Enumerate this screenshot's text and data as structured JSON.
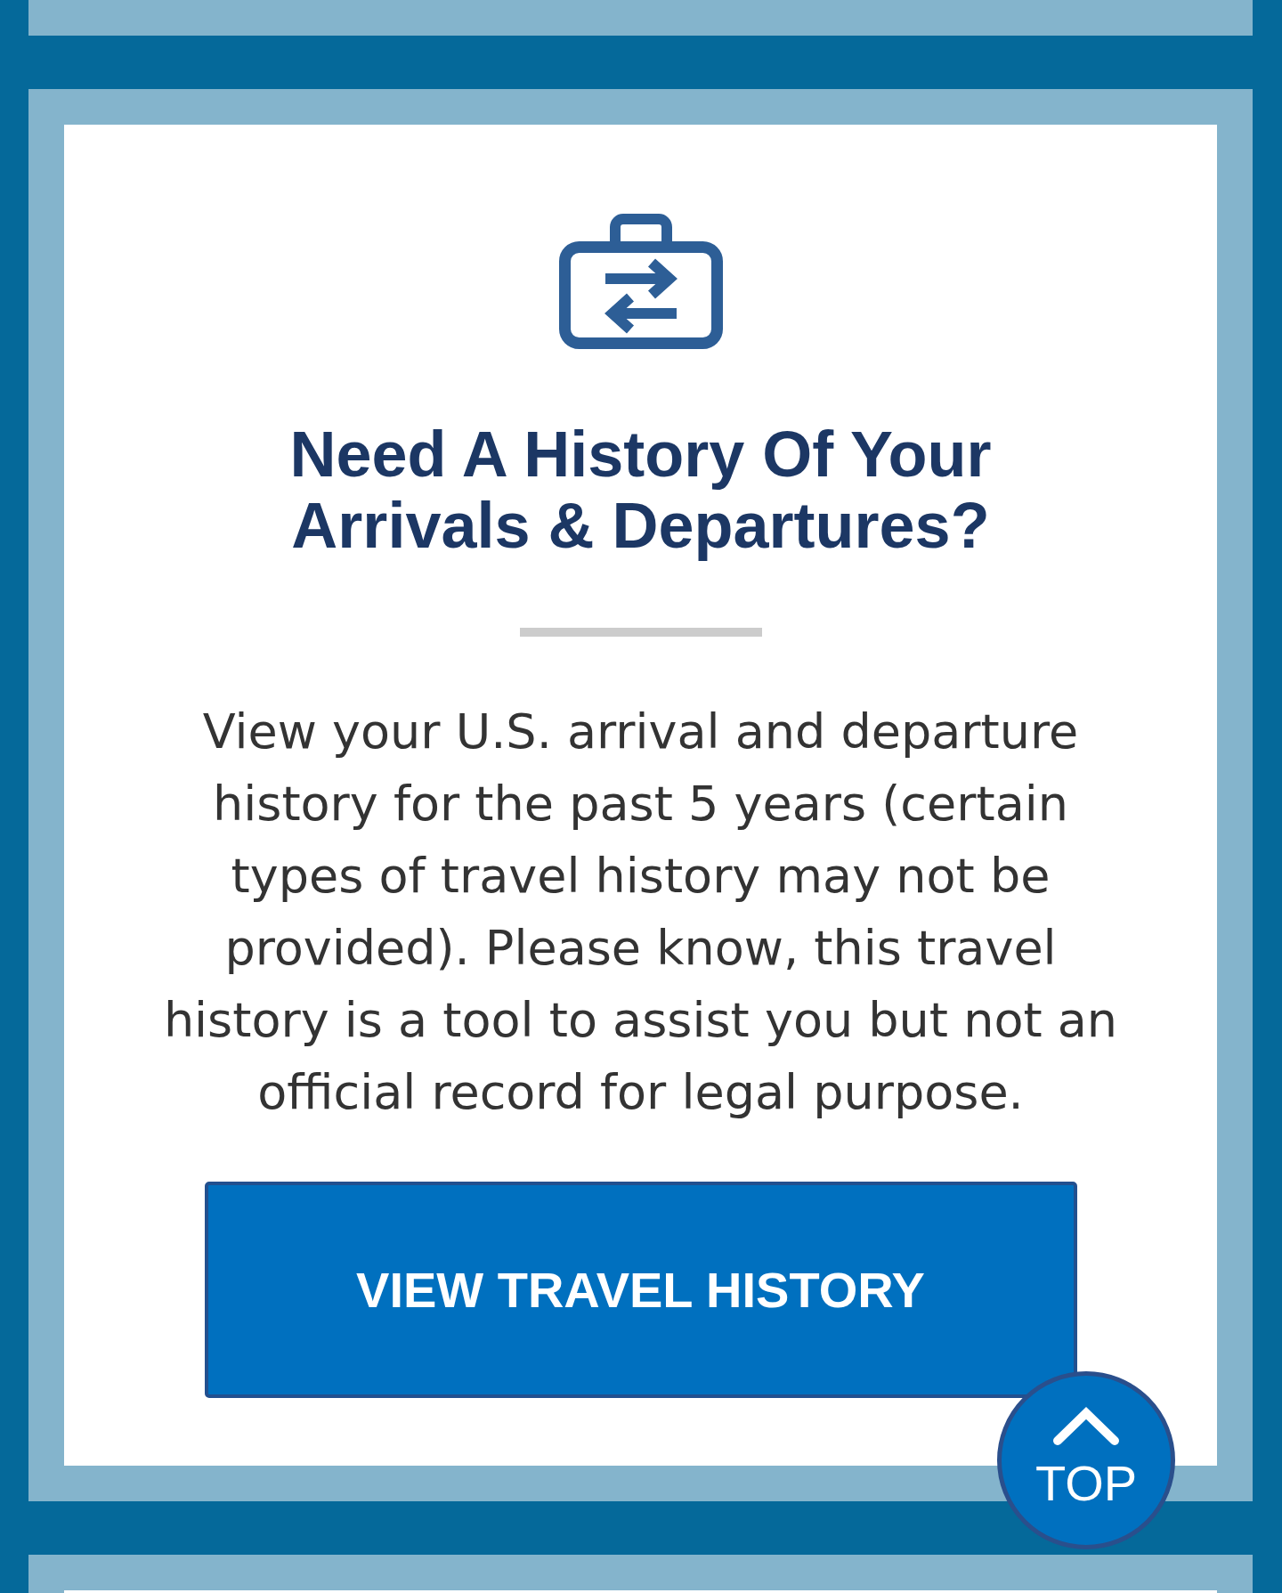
{
  "card": {
    "title": "Need A History Of Your Arrivals & Departures?",
    "description": "View your U.S. arrival and departure history for the past 5 years (certain types of travel history may not be provided). Please know, this travel history is a tool to assist you but not an official record for legal purpose.",
    "button": "VIEW TRAVEL HISTORY"
  },
  "back_to_top": {
    "label": "TOP"
  }
}
